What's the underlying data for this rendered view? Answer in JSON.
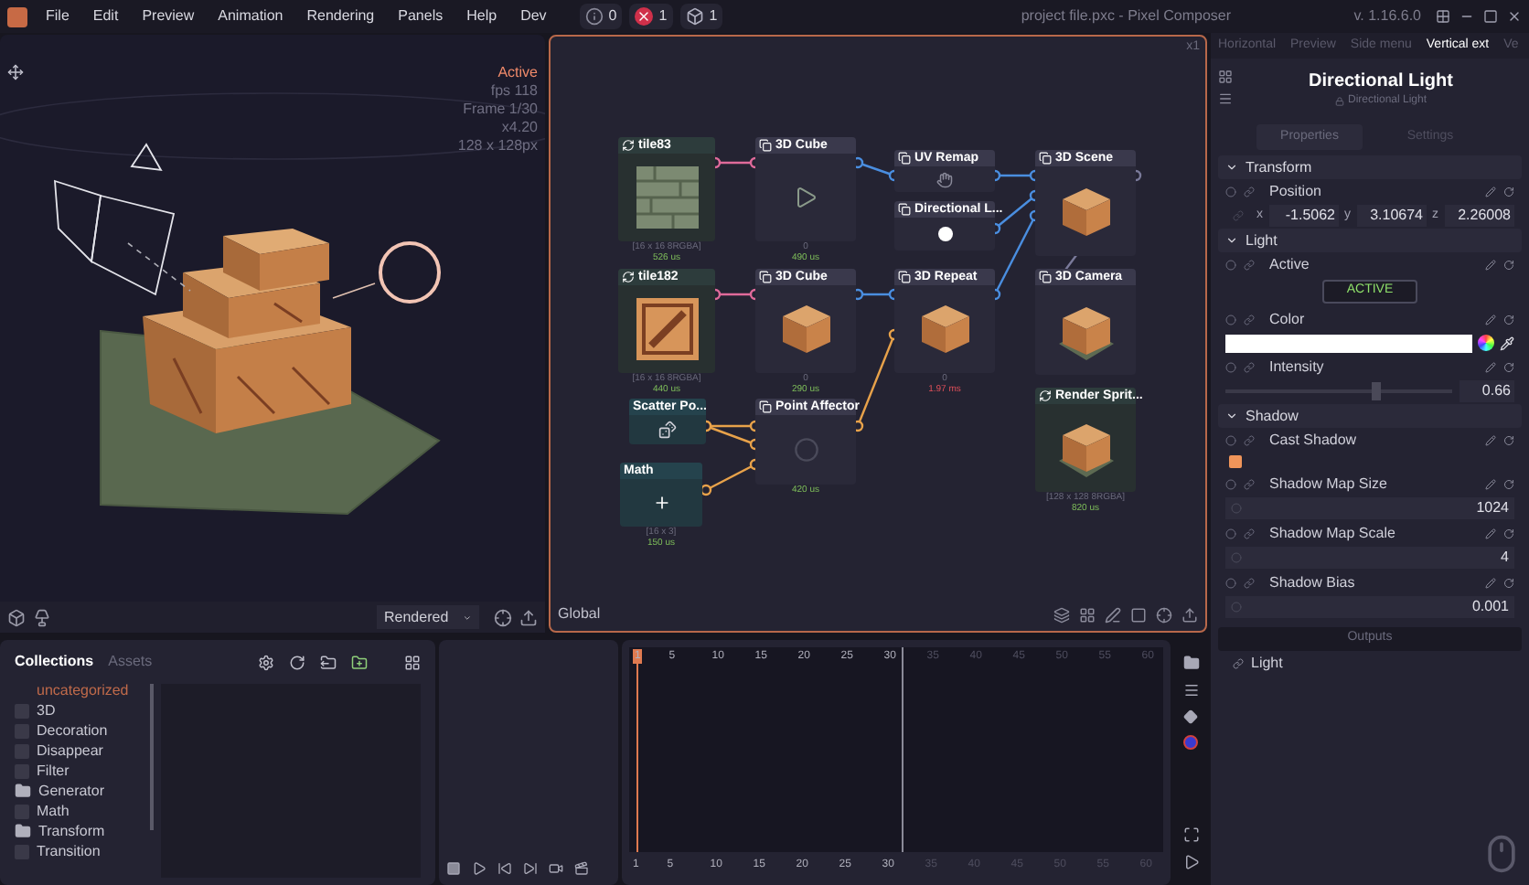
{
  "menu_bar": {
    "items": [
      "File",
      "Edit",
      "Preview",
      "Animation",
      "Rendering",
      "Panels",
      "Help",
      "Dev"
    ],
    "status": [
      {
        "kind": "info",
        "count": "0"
      },
      {
        "kind": "error",
        "count": "1"
      },
      {
        "kind": "nodes",
        "count": "1"
      }
    ],
    "title": "project file.pxc - Pixel Composer",
    "version": "v. 1.16.6.0"
  },
  "preview": {
    "info": [
      {
        "text": "Active",
        "kind": "state"
      },
      {
        "text": "fps 118",
        "kind": "info"
      },
      {
        "text": "Frame 1/30",
        "kind": "info"
      },
      {
        "text": "x4.20",
        "kind": "info"
      },
      {
        "text": "128 x 128px",
        "kind": "info"
      }
    ],
    "render_mode": "Rendered"
  },
  "graph": {
    "zoom": "x1",
    "context": "Global",
    "nodes": [
      {
        "title": "tile83",
        "kind": "surface",
        "footer": [
          {
            "text": "[16 x 16 8RGBA]",
            "kind": "info"
          },
          {
            "text": "526 us",
            "kind": "time"
          }
        ]
      },
      {
        "title": "3D Cube",
        "kind": "object",
        "footer": [
          {
            "text": "0",
            "kind": "info"
          },
          {
            "text": "490 us",
            "kind": "time"
          }
        ]
      },
      {
        "title": "UV Remap",
        "kind": "object"
      },
      {
        "title": "Directional L...",
        "kind": "object"
      },
      {
        "title": "3D Scene",
        "kind": "object"
      },
      {
        "title": "tile182",
        "kind": "surface",
        "footer": [
          {
            "text": "[16 x 16 8RGBA]",
            "kind": "info"
          },
          {
            "text": "440 us",
            "kind": "time"
          }
        ]
      },
      {
        "title": "3D Cube",
        "kind": "object",
        "footer": [
          {
            "text": "0",
            "kind": "info"
          },
          {
            "text": "290 us",
            "kind": "time"
          }
        ]
      },
      {
        "title": "3D Repeat",
        "kind": "object",
        "footer": [
          {
            "text": "0",
            "kind": "info"
          },
          {
            "text": "1.97 ms",
            "kind": "slow"
          }
        ]
      },
      {
        "title": "3D Camera",
        "kind": "object"
      },
      {
        "title": "Scatter Po...",
        "kind": "value"
      },
      {
        "title": "Point Affector",
        "kind": "object",
        "footer": [
          {
            "text": "420 us",
            "kind": "time"
          }
        ]
      },
      {
        "title": "Math",
        "kind": "value",
        "footer": [
          {
            "text": "[16 x 3]",
            "kind": "info"
          },
          {
            "text": "150 us",
            "kind": "time"
          }
        ]
      },
      {
        "title": "Render Sprit...",
        "kind": "surface",
        "footer": [
          {
            "text": "[128 x 128 8RGBA]",
            "kind": "info"
          },
          {
            "text": "820 us",
            "kind": "time"
          }
        ]
      }
    ]
  },
  "inspector": {
    "tabs": [
      {
        "label": "Horizontal",
        "selected": false
      },
      {
        "label": "Preview",
        "selected": false
      },
      {
        "label": "Side menu",
        "selected": false
      },
      {
        "label": "Vertical ext",
        "selected": true
      },
      {
        "label": "Ve",
        "selected": false
      }
    ],
    "title": "Directional Light",
    "subtitle": "Directional Light",
    "subtabs": [
      {
        "label": "Properties",
        "selected": true
      },
      {
        "label": "Settings",
        "selected": false
      }
    ],
    "sections": [
      {
        "title": "Transform",
        "expanded": true,
        "props": [
          {
            "kind": "vector",
            "label": "Position",
            "axes": [
              {
                "axis": "x",
                "value": "-1.5062"
              },
              {
                "axis": "y",
                "value": "3.10674"
              },
              {
                "axis": "z",
                "value": "2.26008"
              }
            ]
          }
        ]
      },
      {
        "title": "Light",
        "expanded": true,
        "props": [
          {
            "kind": "toggle",
            "label": "Active",
            "button": "ACTIVE",
            "on": true
          },
          {
            "kind": "color",
            "label": "Color",
            "color": "#ffffff"
          },
          {
            "kind": "slider",
            "label": "Intensity",
            "level": 0.66,
            "value": "0.66"
          }
        ]
      },
      {
        "title": "Shadow",
        "expanded": true,
        "props": [
          {
            "kind": "checkbox",
            "label": "Cast Shadow",
            "checked": true
          },
          {
            "kind": "number",
            "label": "Shadow Map Size",
            "value": "1024"
          },
          {
            "kind": "number",
            "label": "Shadow Map Scale",
            "value": "4"
          },
          {
            "kind": "number",
            "label": "Shadow Bias",
            "value": "0.001"
          }
        ]
      }
    ],
    "outputs": {
      "title": "Outputs",
      "items": [
        "Light"
      ]
    }
  },
  "library": {
    "tabs": [
      {
        "label": "Collections",
        "selected": true
      },
      {
        "label": "Assets",
        "selected": false
      }
    ],
    "folders": [
      {
        "label": "uncategorized",
        "kind": "category"
      },
      {
        "label": "3D",
        "kind": "empty"
      },
      {
        "label": "Decoration",
        "kind": "empty"
      },
      {
        "label": "Disappear",
        "kind": "empty"
      },
      {
        "label": "Filter",
        "kind": "empty"
      },
      {
        "label": "Generator",
        "kind": "folder"
      },
      {
        "label": "Math",
        "kind": "empty"
      },
      {
        "label": "Transform",
        "kind": "folder"
      },
      {
        "label": "Transition",
        "kind": "empty"
      }
    ]
  },
  "timeline": {
    "ruler": [
      {
        "label": "1",
        "selected": true,
        "in_range": true
      },
      {
        "label": "5",
        "selected": false,
        "in_range": true
      },
      {
        "label": "10",
        "selected": false,
        "in_range": true
      },
      {
        "label": "15",
        "selected": false,
        "in_range": true
      },
      {
        "label": "20",
        "selected": false,
        "in_range": true
      },
      {
        "label": "25",
        "selected": false,
        "in_range": true
      },
      {
        "label": "30",
        "selected": false,
        "in_range": true
      },
      {
        "label": "35",
        "selected": false,
        "in_range": false
      },
      {
        "label": "40",
        "selected": false,
        "in_range": false
      },
      {
        "label": "45",
        "selected": false,
        "in_range": false
      },
      {
        "label": "50",
        "selected": false,
        "in_range": false
      },
      {
        "label": "55",
        "selected": false,
        "in_range": false
      },
      {
        "label": "60",
        "selected": false,
        "in_range": false
      }
    ],
    "bottom_ruler": [
      {
        "label": "1",
        "in_range": true
      },
      {
        "label": "5",
        "in_range": true
      },
      {
        "label": "10",
        "in_range": true
      },
      {
        "label": "15",
        "in_range": true
      },
      {
        "label": "20",
        "in_range": true
      },
      {
        "label": "25",
        "in_range": true
      },
      {
        "label": "30",
        "in_range": true
      },
      {
        "label": "35",
        "in_range": false
      },
      {
        "label": "40",
        "in_range": false
      },
      {
        "label": "45",
        "in_range": false
      },
      {
        "label": "50",
        "in_range": false
      },
      {
        "label": "55",
        "in_range": false
      },
      {
        "label": "60",
        "in_range": false
      }
    ]
  }
}
